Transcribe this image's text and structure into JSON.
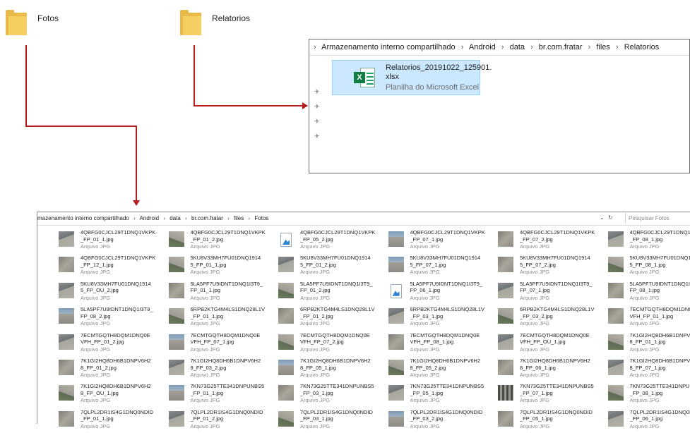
{
  "folders": [
    {
      "label": "Fotos"
    },
    {
      "label": "Relatorios"
    }
  ],
  "relatorios_window": {
    "breadcrumb": [
      "Armazenamento interno compartilhado",
      "Android",
      "data",
      "br.com.fratar",
      "files",
      "Relatorios"
    ],
    "file": {
      "name_line1": "Relatorios_20191022_125901.",
      "name_line2": "xlsx",
      "type": "Planilha do Microsoft Excel",
      "icon": "excel-icon"
    }
  },
  "fotos_window": {
    "breadcrumb": [
      "mazenamento interno compartilhado",
      "Android",
      "data",
      "br.com.fratar",
      "files",
      "Fotos"
    ],
    "search_placeholder": "Pesquisar Fotos",
    "controls": {
      "dropdown": "⌄",
      "refresh": "↻"
    },
    "file_type": "Arquivo JPG",
    "files": [
      [
        "4QBFG0CJCL29T1DNQ1VKPK",
        "_FP_01_1.jpg",
        "t1"
      ],
      [
        "4QBFG0CJCL29T1DNQ1VKPK",
        "_FP_01_2.jpg",
        "t2"
      ],
      [
        "4QBFG0CJCL29T1DNQ1VKPK",
        "_FP_05_2.jpg",
        "generic"
      ],
      [
        "4QBFG0CJCL29T1DNQ1VKPK",
        "_FP_07_1.jpg",
        "t4"
      ],
      [
        "4QBFG0CJCL29T1DNQ1VKPK",
        "_FP_07_2.jpg",
        "t3"
      ],
      [
        "4QBFG0CJCL29T1DNQ1VKPK",
        "_FP_08_1.jpg",
        "t1"
      ],
      [
        "4QBFG0CJCL29T1DNQ1VKPK",
        "_FP_12_1.jpg",
        "t3"
      ],
      [
        "5KU8V33MH7FU01DNQ1914",
        "5_FP_01_1.jpg",
        "t2"
      ],
      [
        "5KU8V33MH7FU01DNQ1914",
        "5_FP_01_2.jpg",
        "t1"
      ],
      [
        "5KU8V33MH7FU01DNQ1914",
        "5_FP_07_1.jpg",
        "t4"
      ],
      [
        "5KU8V33MH7FU01DNQ1914",
        "5_FP_07_2.jpg",
        "t3"
      ],
      [
        "5KU8V33MH7FU01DNQ1914",
        "5_FP_08_1.jpg",
        "t2"
      ],
      [
        "5KU8V33MH7FU01DNQ1914",
        "5_FP_OU_2.jpg",
        "t1"
      ],
      [
        "5LA5PF7U9IDNT1DNQ1I3T9_",
        "FP_01_1.jpg",
        "t3"
      ],
      [
        "5LA5PF7U9IDNT1DNQ1I3T9_",
        "FP_01_2.jpg",
        "t2"
      ],
      [
        "5LA5PF7U9IDNT1DNQ1I3T9_",
        "FP_06_1.jpg",
        "generic"
      ],
      [
        "5LA5PF7U9IDNT1DNQ1I3T9_",
        "FP_07_1.jpg",
        "t1"
      ],
      [
        "5LA5PF7U9IDNT1DNQ1I3T9_",
        "FP_08_1.jpg",
        "t3"
      ],
      [
        "5LA5PF7U9IDNT1DNQ1I3T9_",
        "FP_08_2.jpg",
        "t4"
      ],
      [
        "6RPB2KTG4M4LS1DNQ28L1V",
        "_FP_01_1.jpg",
        "t2"
      ],
      [
        "6RPB2KTG4M4LS1DNQ28L1V",
        "_FP_01_2.jpg",
        "t3"
      ],
      [
        "6RPB2KTG4M4LS1DNQ28L1V",
        "_FP_03_1.jpg",
        "t1"
      ],
      [
        "6RPB2KTG4M4LS1DNQ28L1V",
        "_FP_03_2.jpg",
        "t2"
      ],
      [
        "7ECMTGQTH8DQM1DNQ0E",
        "VFH_FP_01_1.jpg",
        "t3"
      ],
      [
        "7ECMTGQTH8DQM1DNQ0E",
        "VFH_FP_01_2.jpg",
        "t1"
      ],
      [
        "7ECMTGQTH8DQM1DNQ0E",
        "VFH_FP_07_1.jpg",
        "t4"
      ],
      [
        "7ECMTGQTH8DQM1DNQ0E",
        "VFH_FP_07_2.jpg",
        "t2"
      ],
      [
        "7ECMTGQTH8DQM1DNQ0E",
        "VFH_FP_08_1.jpg",
        "t3"
      ],
      [
        "7ECMTGQTH8DQM1DNQ0E",
        "VFH_FP_OU_1.jpg",
        "t1"
      ],
      [
        "7K1GI2HQ8DH6B1DNPV6H2",
        "8_FP_01_1.jpg",
        "t2"
      ],
      [
        "7K1GI2HQ8DH6B1DNPV6H2",
        "8_FP_01_2.jpg",
        "t3"
      ],
      [
        "7K1GI2HQ8DH6B1DNPV6H2",
        "8_FP_03_2.jpg",
        "t1"
      ],
      [
        "7K1GI2HQ8DH6B1DNPV6H2",
        "8_FP_05_1.jpg",
        "t4"
      ],
      [
        "7K1GI2HQ8DH6B1DNPV6H2",
        "8_FP_05_2.jpg",
        "t2"
      ],
      [
        "7K1GI2HQ8DH6B1DNPV6H2",
        "8_FP_06_1.jpg",
        "t3"
      ],
      [
        "7K1GI2HQ8DH6B1DNPV6H2",
        "8_FP_07_1.jpg",
        "t1"
      ],
      [
        "7K1GI2HQ8DH6B1DNPV6H2",
        "8_FP_OU_1.jpg",
        "t2"
      ],
      [
        "7KN73G25TTE341DNPUNBS5",
        "_FP_01_1.jpg",
        "t4"
      ],
      [
        "7KN73G25TTE341DNPUNBS5",
        "_FP_03_1.jpg",
        "t3"
      ],
      [
        "7KN73G25TTE341DNPUNBS5",
        "_FP_05_1.jpg",
        "t1"
      ],
      [
        "7KN73G25TTE341DNPUNBS5",
        "_FP_07_1.jpg",
        "t5"
      ],
      [
        "7KN73G25TTE341DNPUNBS5",
        "_FP_08_1.jpg",
        "t2"
      ],
      [
        "7QLPL2DR1IS4G1DNQ0NDID",
        "_FP_01_1.jpg",
        "t3"
      ],
      [
        "7QLPL2DR1IS4G1DNQ0NDID",
        "_FP_01_2.jpg",
        "t1"
      ],
      [
        "7QLPL2DR1IS4G1DNQ0NDID",
        "_FP_03_1.jpg",
        "t2"
      ],
      [
        "7QLPL2DR1IS4G1DNQ0NDID",
        "_FP_03_2.jpg",
        "t4"
      ],
      [
        "7QLPL2DR1IS4G1DNQ0NDID",
        "_FP_05_1.jpg",
        "t3"
      ],
      [
        "7QLPL2DR1IS4G1DNQ0NDID",
        "_FP_06_1.jpg",
        "t1"
      ]
    ]
  },
  "colors": {
    "arrow": "#b71c1c",
    "selection": "#cce8ff",
    "folder": "#e8b948",
    "excel": "#107c41"
  }
}
